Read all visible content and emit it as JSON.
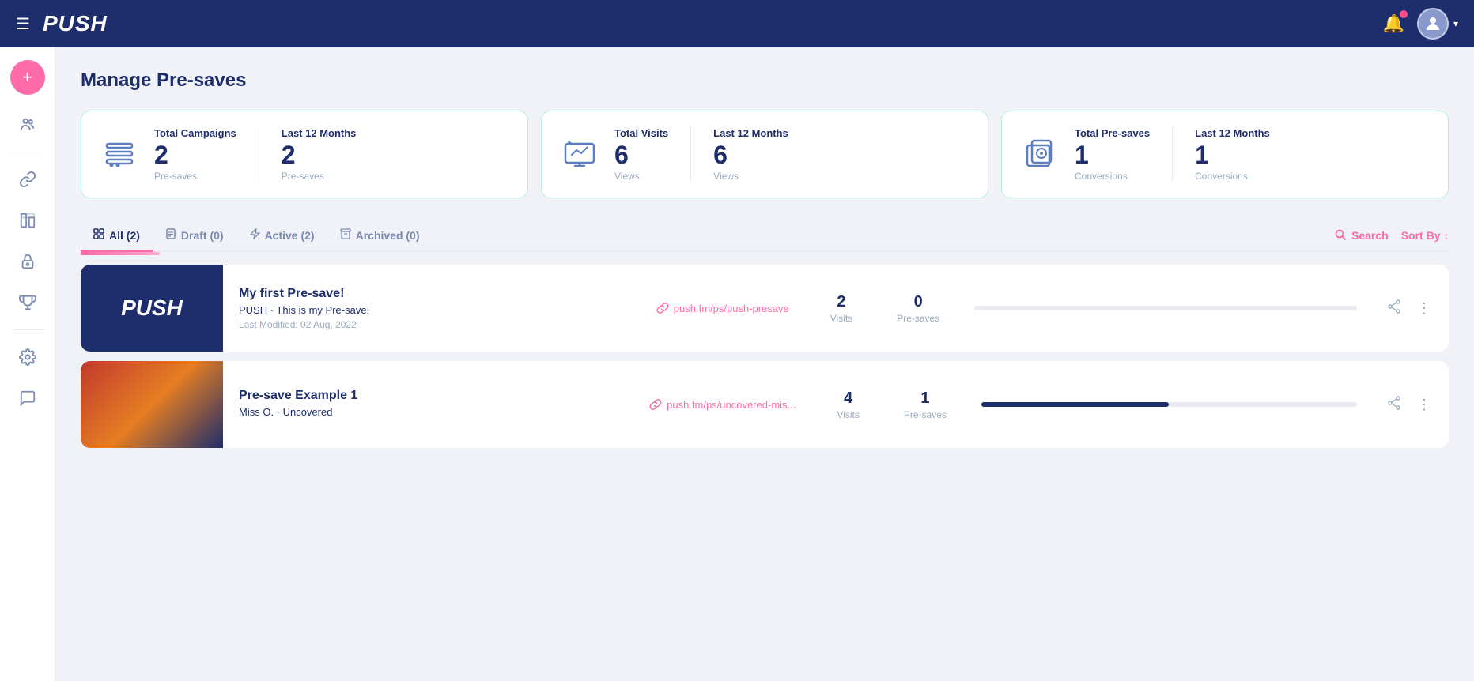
{
  "topnav": {
    "logo": "PUSH",
    "hamburger": "☰"
  },
  "sidebar": {
    "add_icon": "+",
    "items": [
      {
        "id": "audience",
        "icon": "👥",
        "label": "Audience"
      },
      {
        "id": "links",
        "icon": "🔗",
        "label": "Links"
      },
      {
        "id": "analytics",
        "icon": "📊",
        "label": "Analytics"
      },
      {
        "id": "lock",
        "icon": "🔒",
        "label": "Lock"
      },
      {
        "id": "trophy",
        "icon": "🏆",
        "label": "Trophy"
      },
      {
        "id": "settings",
        "icon": "⚙️",
        "label": "Settings"
      },
      {
        "id": "chat",
        "icon": "💬",
        "label": "Chat"
      }
    ]
  },
  "page": {
    "title": "Manage Pre-saves"
  },
  "stats": [
    {
      "id": "campaigns",
      "icon": "lines",
      "col1_label": "Total Campaigns",
      "col1_number": "2",
      "col1_sub": "Pre-saves",
      "col2_label": "Last 12 Months",
      "col2_number": "2",
      "col2_sub": "Pre-saves"
    },
    {
      "id": "visits",
      "icon": "screen",
      "col1_label": "Total Visits",
      "col1_number": "6",
      "col1_sub": "Views",
      "col2_label": "Last 12 Months",
      "col2_number": "6",
      "col2_sub": "Views"
    },
    {
      "id": "presaves",
      "icon": "camera",
      "col1_label": "Total Pre-saves",
      "col1_number": "1",
      "col1_sub": "Conversions",
      "col2_label": "Last 12 Months",
      "col2_number": "1",
      "col2_sub": "Conversions"
    }
  ],
  "tabs": [
    {
      "id": "all",
      "icon": "grid",
      "label": "All",
      "count": 2,
      "active": true
    },
    {
      "id": "draft",
      "icon": "doc",
      "label": "Draft",
      "count": 0,
      "active": false
    },
    {
      "id": "active",
      "icon": "bolt",
      "label": "Active",
      "count": 2,
      "active": false
    },
    {
      "id": "archived",
      "icon": "archive",
      "label": "Archived",
      "count": 0,
      "active": false
    }
  ],
  "search_label": "Search",
  "sort_label": "Sort By",
  "campaigns": [
    {
      "id": "push-presave",
      "thumbnail_type": "push",
      "name": "My first Pre-save!",
      "description": "PUSH · This is my Pre-save!",
      "date": "Last Modified: 02 Aug, 2022",
      "link": "push.fm/ps/push-presave",
      "visits_num": "2",
      "visits_label": "Visits",
      "presaves_num": "0",
      "presaves_label": "Pre-saves",
      "bar_fill_pct": 0
    },
    {
      "id": "uncovered",
      "thumbnail_type": "example",
      "name": "Pre-save Example 1",
      "description": "Miss O. · Uncovered",
      "date": "",
      "link": "push.fm/ps/uncovered-mis...",
      "visits_num": "4",
      "visits_label": "Visits",
      "presaves_num": "1",
      "presaves_label": "Pre-saves",
      "bar_fill_pct": 50
    }
  ]
}
